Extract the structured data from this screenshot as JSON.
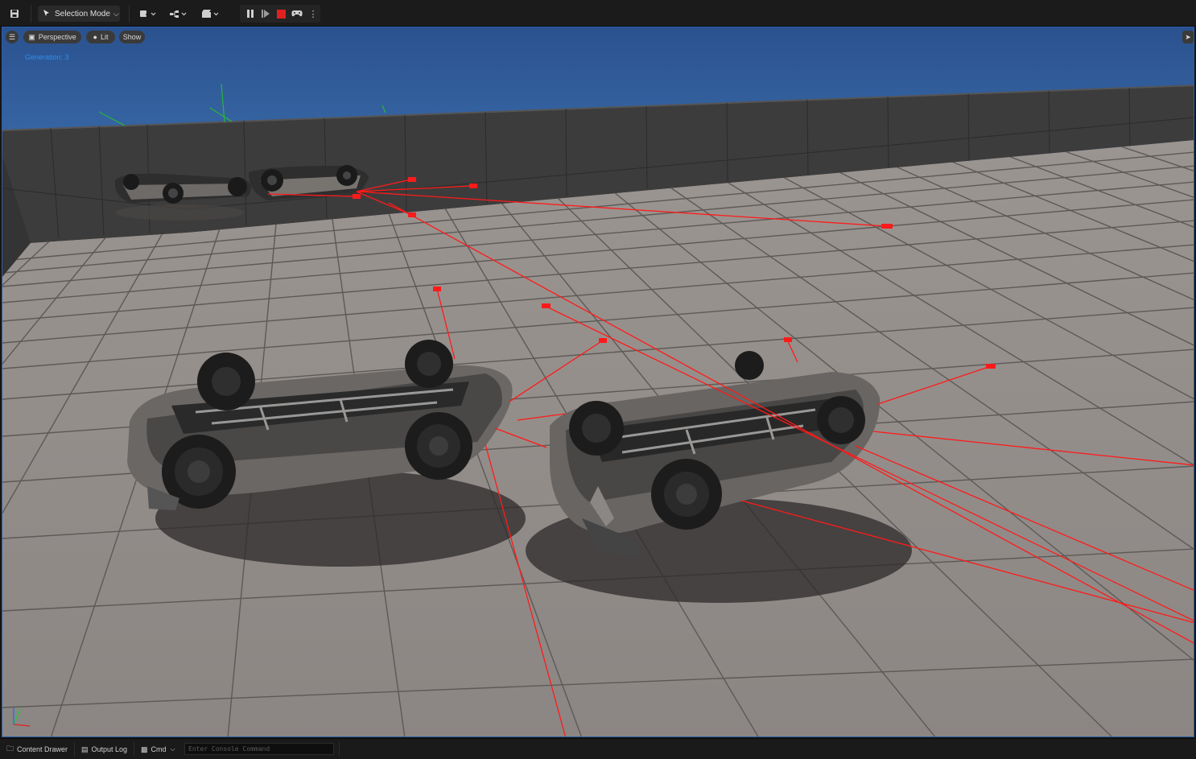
{
  "toolbar": {
    "selection_mode_label": "Selection Mode"
  },
  "viewport": {
    "perspective_label": "Perspective",
    "lit_label": "Lit",
    "show_label": "Show",
    "generation_text": "Generation: 3"
  },
  "statusbar": {
    "content_drawer_label": "Content Drawer",
    "output_log_label": "Output Log",
    "cmd_label": "Cmd",
    "console_placeholder": "Enter Console Command"
  },
  "colors": {
    "sky": "#2f5a98",
    "floor": "#8f8a86",
    "wall": "#3c3b3b",
    "trace_line": "#ff1a1a",
    "accent_blue": "#2e8ef0",
    "stop_red": "#e02020"
  }
}
